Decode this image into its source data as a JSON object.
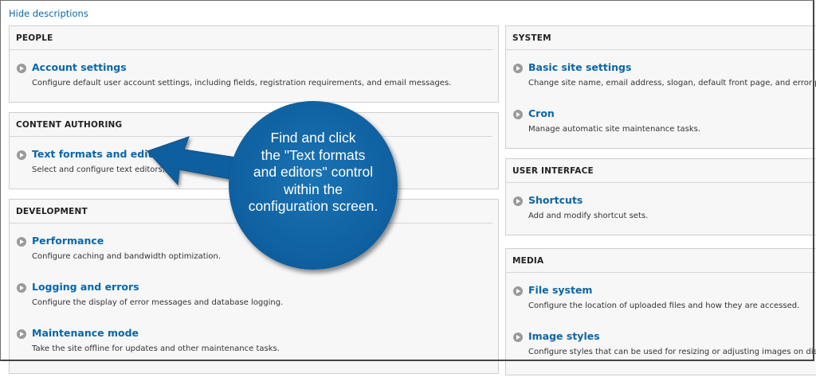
{
  "top_link": "Hide descriptions",
  "left_column": [
    {
      "title": "PEOPLE",
      "items": [
        {
          "label": "Account settings",
          "desc": "Configure default user account settings, including fields, registration requirements, and email messages."
        }
      ]
    },
    {
      "title": "CONTENT AUTHORING",
      "items": [
        {
          "label": "Text formats and editors",
          "desc": "Select and configure text editors,"
        }
      ]
    },
    {
      "title": "DEVELOPMENT",
      "items": [
        {
          "label": "Performance",
          "desc": "Configure caching and bandwidth optimization."
        },
        {
          "label": "Logging and errors",
          "desc": "Configure the display of error messages and database logging."
        },
        {
          "label": "Maintenance mode",
          "desc": "Take the site offline for updates and other maintenance tasks."
        }
      ]
    }
  ],
  "right_column": [
    {
      "title": "SYSTEM",
      "items": [
        {
          "label": "Basic site settings",
          "desc": "Change site name, email address, slogan, default front page, and error pa"
        },
        {
          "label": "Cron",
          "desc": "Manage automatic site maintenance tasks."
        }
      ]
    },
    {
      "title": "USER INTERFACE",
      "items": [
        {
          "label": "Shortcuts",
          "desc": "Add and modify shortcut sets."
        }
      ]
    },
    {
      "title": "MEDIA",
      "items": [
        {
          "label": "File system",
          "desc": "Configure the location of uploaded files and how they are accessed."
        },
        {
          "label": "Image styles",
          "desc": "Configure styles that can be used for resizing or adjusting images on disp"
        }
      ]
    }
  ],
  "callout": {
    "lines": [
      "Find and click",
      "the \"Text formats",
      "and editors\" control",
      "within the",
      "configuration screen."
    ]
  },
  "colors": {
    "link": "#0a66a8",
    "callout": "#0e5f9f",
    "panel_bg": "#f7f7f7"
  }
}
